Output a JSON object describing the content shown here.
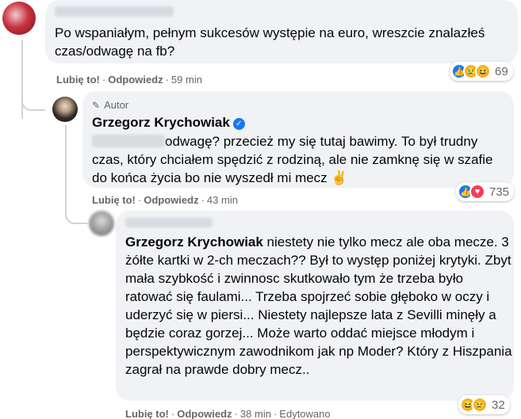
{
  "comment1": {
    "text": "Po wspaniałym, pełnym sukcesów występie na euro, wreszcie znalazłeś czas/odwagę na fb?",
    "actions": {
      "like": "Lubię to!",
      "reply": "Odpowiedz",
      "time": "59 min"
    },
    "reactions": {
      "icons": [
        "like-icon",
        "sad-icon",
        "haha-icon"
      ],
      "count": "69"
    }
  },
  "reply1": {
    "badge": "Autor",
    "name": "Grzegorz Krychowiak",
    "text_line1": "odwagę? przecież my się tutaj bawimy. To był",
    "text_rest": "trudny czas, który chciałem spędzić z rodziną, ale nie zamknę się w szafie do końca życia bo nie wyszedł mi mecz ✌",
    "actions": {
      "like": "Lubię to!",
      "reply": "Odpowiedz",
      "time": "43 min"
    },
    "reactions": {
      "icons": [
        "like-icon",
        "love-icon"
      ],
      "count": "735"
    }
  },
  "reply2": {
    "mention": "Grzegorz Krychowiak",
    "text": " niestety nie tylko mecz ale oba mecze. 3 żółte kartki w 2-ch meczach?? Był to występ poniżej krytyki. Zbyt mała szybkość i zwinnosc skutkowało tym że trzeba było ratować się faulami... Trzeba spojrzeć sobie głęboko w oczy i uderzyć się w piersi... Niestety najlepsze lata z Sevilli minęły a będzie coraz gorzej... Może warto oddać miejsce młodym i perspektywicznym zawodnikom jak np Moder? Który z Hiszpania zagrał na prawde dobry mecz..",
    "actions": {
      "like": "Lubię to!",
      "reply": "Odpowiedz",
      "time": "38 min",
      "edited": "Edytowano"
    },
    "reactions": {
      "icons": [
        "haha-icon",
        "sad-icon"
      ],
      "count": "32"
    }
  }
}
